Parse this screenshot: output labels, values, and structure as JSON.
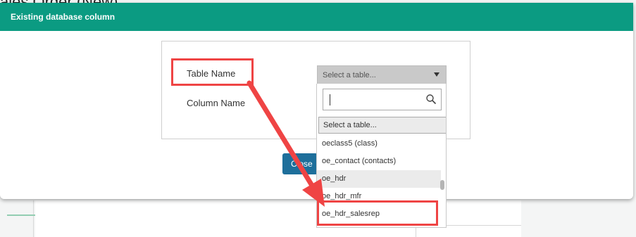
{
  "background": {
    "page_title": "ales Order (New)"
  },
  "modal": {
    "title": "Existing database column",
    "fields": {
      "table_name_label": "Table Name",
      "column_name_label": "Column Name"
    },
    "table_select": {
      "selected_text": "Select a table..."
    },
    "close_button": "Close"
  },
  "dropdown": {
    "search_value": "",
    "placeholder_option": "Select a table...",
    "options": [
      "oeclass5 (class)",
      "oe_contact (contacts)",
      "oe_hdr",
      "oe_hdr_mfr",
      "oe_hdr_salesrep"
    ],
    "hovered_option": "oe_hdr"
  },
  "colors": {
    "header": "#0b9b82",
    "close_button": "#1e6f9b",
    "highlight": "#ef4444"
  },
  "icons": [
    "search-icon",
    "caret-down-icon"
  ]
}
